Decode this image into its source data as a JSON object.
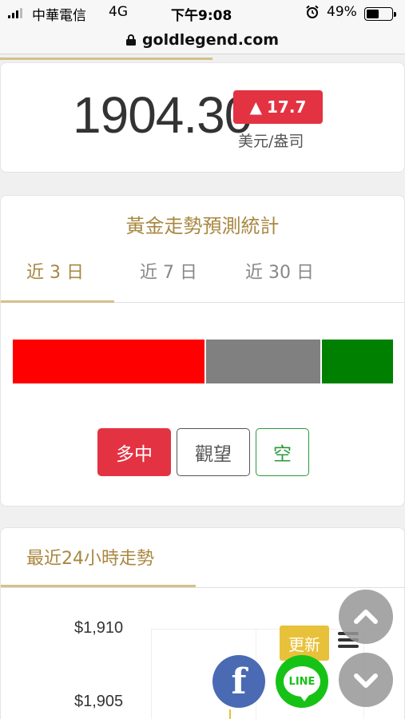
{
  "status_bar": {
    "carrier": "中華電信",
    "network": "4G",
    "time": "下午9:08",
    "battery_text": "49%",
    "battery_level": 0.49
  },
  "browser": {
    "url": "goldlegend.com"
  },
  "price_card": {
    "price": "1904.30",
    "change_arrow": "▲",
    "change_value": "17.7",
    "unit": "美元/盎司",
    "change_color": "#e33342"
  },
  "forecast": {
    "title": "黃金走勢預測統計",
    "tabs": [
      {
        "label": "近 3 日",
        "active": true
      },
      {
        "label": "近 7 日",
        "active": false
      },
      {
        "label": "近 30 日",
        "active": false
      }
    ],
    "distribution": [
      {
        "key": "long",
        "share": 0.509,
        "color": "#ff0000"
      },
      {
        "key": "watch",
        "share": 0.305,
        "color": "#808080"
      },
      {
        "key": "short",
        "share": 0.186,
        "color": "#008000"
      }
    ],
    "buttons": {
      "long": "多中",
      "watch": "觀望",
      "short": "空"
    }
  },
  "trend24h": {
    "title": "最近24小時走勢",
    "y_ticks": [
      "$1,910",
      "$1,905"
    ]
  },
  "floating": {
    "update_label": "更新",
    "line_label": "LINE",
    "facebook_label": "f"
  },
  "icons": [
    "signal-icon",
    "alarm-icon",
    "battery-icon",
    "lock-icon",
    "facebook-icon",
    "line-icon",
    "chevron-up-icon",
    "chevron-down-icon",
    "menu-icon"
  ]
}
